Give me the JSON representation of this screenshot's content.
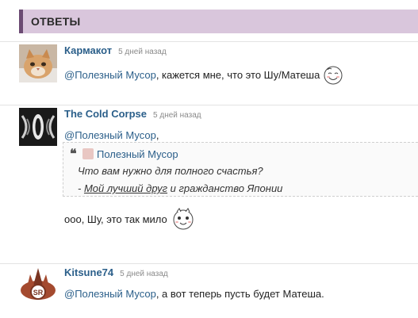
{
  "section": {
    "title": "ОТВЕТЫ"
  },
  "comments": [
    {
      "author": "Кармакот",
      "time": "5 дней назад",
      "mention": "@Полезный Мусор",
      "text": ", кажется мне, что это Шу/Матеша",
      "avatar": "cat-avatar"
    },
    {
      "author": "The  Cold  Corpse",
      "time": "5 дней назад",
      "mention": "@Полезный Мусор",
      "text": ",",
      "quote": {
        "marks": "❝",
        "author": "Полезный Мусор",
        "line1": "Что вам нужно для полного счастья?",
        "line2_prefix": "- ",
        "line2_link": "Мой лучший друг",
        "line2_suffix": " и гражданство Японии"
      },
      "after_text": "ооо, Шу, это так мило",
      "avatar": "dark-pattern-avatar"
    },
    {
      "author": "Kitsune74",
      "time": "5 дней назад",
      "mention": "@Полезный Мусор",
      "text": ", а вот теперь пусть будет Матеша.",
      "avatar": "fox-avatar"
    }
  ]
}
